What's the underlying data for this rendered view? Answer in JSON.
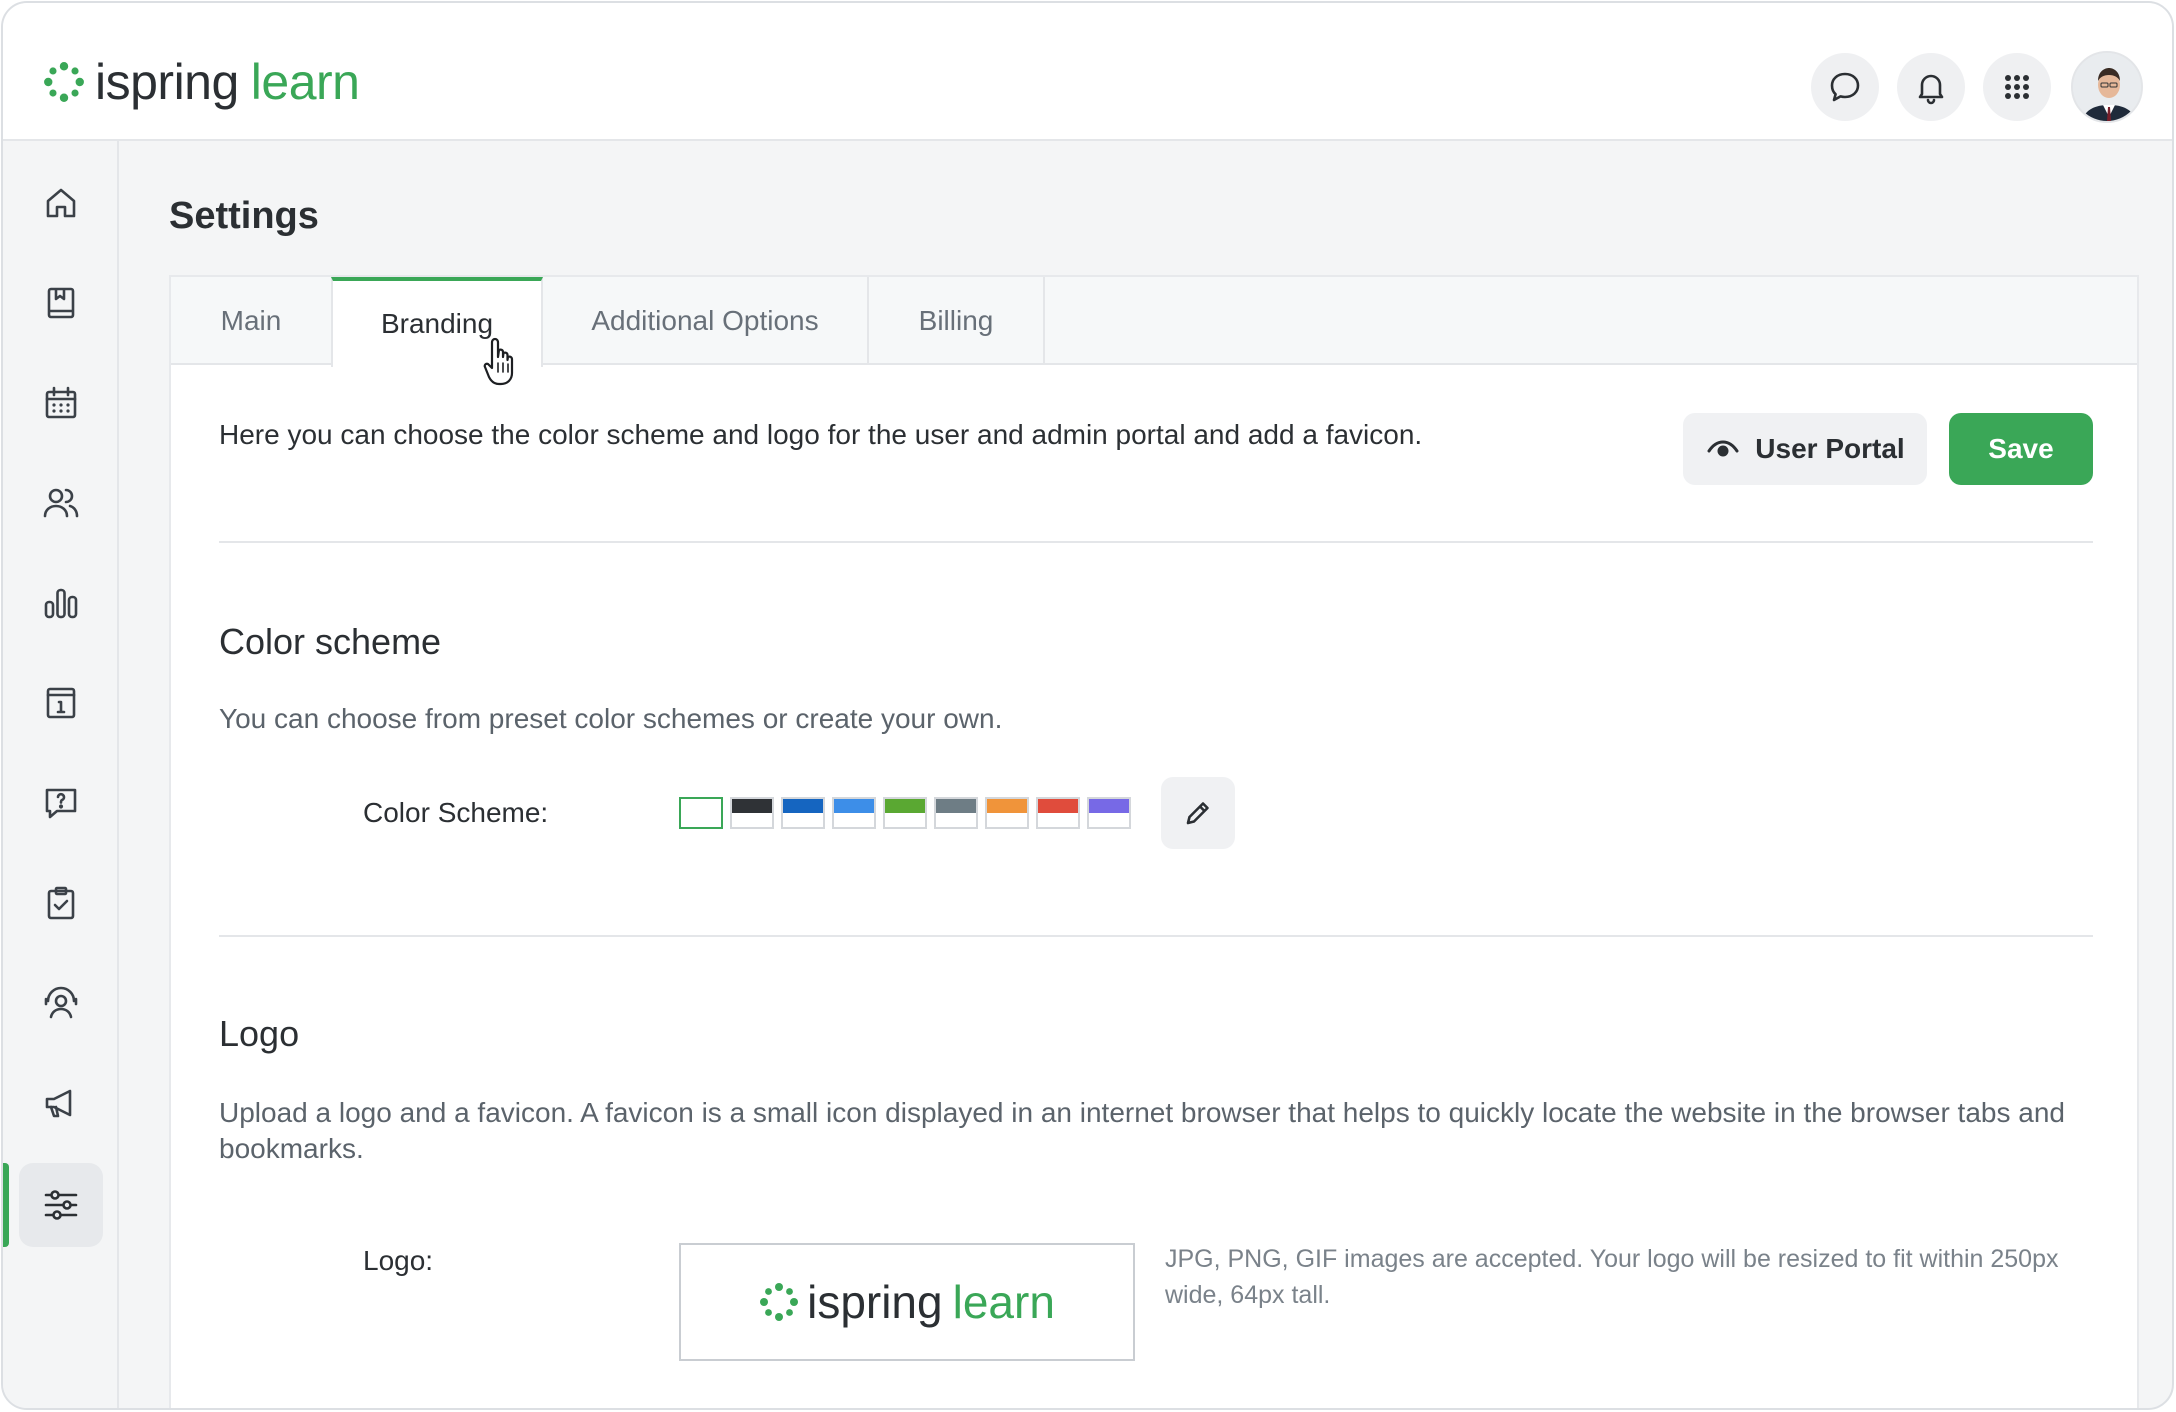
{
  "app": {
    "brand_part1": "ispring",
    "brand_part2": "learn",
    "accent_color": "#3aa757"
  },
  "header": {
    "icons": [
      "chat-icon",
      "bell-icon",
      "apps-grid-icon"
    ],
    "avatar": "user-avatar"
  },
  "sidebar": {
    "items": [
      {
        "icon": "home-icon"
      },
      {
        "icon": "book-icon"
      },
      {
        "icon": "calendar-icon"
      },
      {
        "icon": "users-icon"
      },
      {
        "icon": "reports-icon"
      },
      {
        "icon": "info-board-icon"
      },
      {
        "icon": "question-icon"
      },
      {
        "icon": "clipboard-check-icon"
      },
      {
        "icon": "support-user-icon"
      },
      {
        "icon": "megaphone-icon"
      },
      {
        "icon": "settings-sliders-icon",
        "active": true
      }
    ]
  },
  "page": {
    "title": "Settings"
  },
  "tabs": [
    {
      "label": "Main"
    },
    {
      "label": "Branding",
      "active": true
    },
    {
      "label": "Additional Options"
    },
    {
      "label": "Billing"
    }
  ],
  "branding": {
    "intro": "Here you can choose the color scheme and logo for the user and admin portal and add a favicon.",
    "user_portal_label": "User Portal",
    "save_label": "Save",
    "color_scheme": {
      "title": "Color scheme",
      "description": "You can choose from preset color schemes or create your own.",
      "field_label": "Color Scheme:",
      "swatches": [
        "#ffffff",
        "#2f3236",
        "#1565c0",
        "#3d8ee8",
        "#5aa832",
        "#6e7d85",
        "#f0943a",
        "#e04c3c",
        "#7769e6"
      ],
      "selected_index": 0
    },
    "logo": {
      "title": "Logo",
      "description": "Upload a logo and a favicon. A favicon is a small icon displayed in an internet browser that helps to quickly locate the website in the browser tabs and bookmarks.",
      "field_label": "Logo:",
      "hint": "JPG, PNG, GIF images are accepted. Your logo will be resized to fit within 250px wide, 64px tall."
    }
  }
}
